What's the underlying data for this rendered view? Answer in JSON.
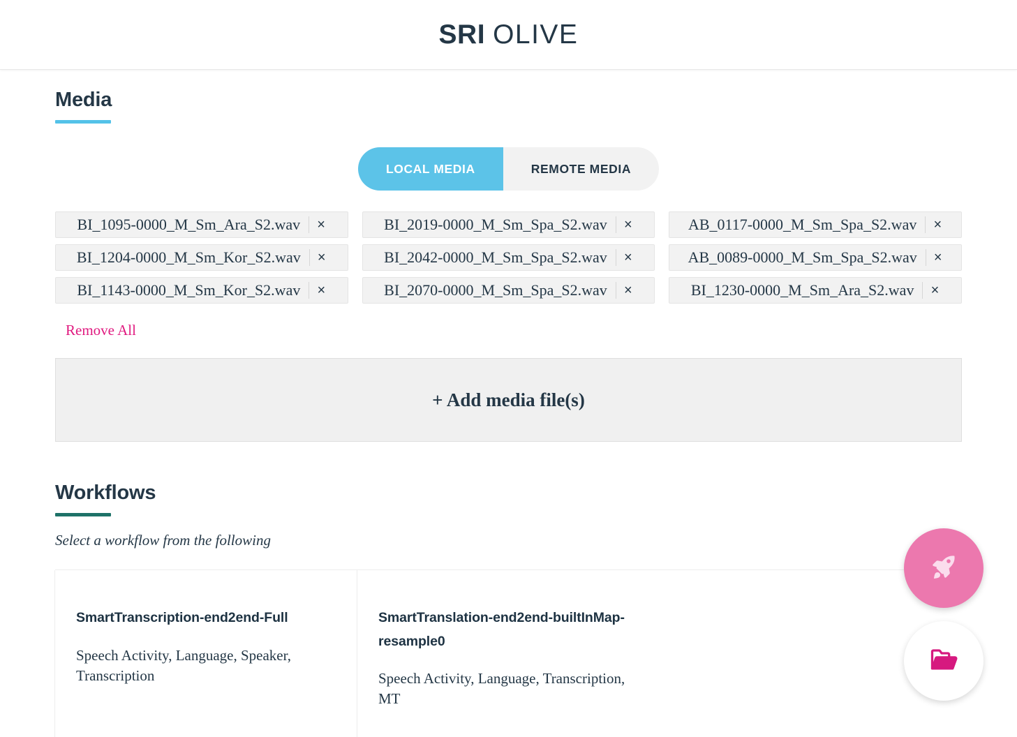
{
  "header": {
    "logo_primary": "SRI",
    "logo_secondary": "OLIVE"
  },
  "media": {
    "section_title": "Media",
    "toggle": {
      "local_label": "LOCAL MEDIA",
      "remote_label": "REMOTE MEDIA",
      "active": "LOCAL MEDIA"
    },
    "files": [
      {
        "name": "BI_1095-0000_M_Sm_Ara_S2.wav",
        "close": "×"
      },
      {
        "name": "BI_2019-0000_M_Sm_Spa_S2.wav",
        "close": "×"
      },
      {
        "name": "AB_0117-0000_M_Sm_Spa_S2.wav",
        "close": "×"
      },
      {
        "name": "BI_1204-0000_M_Sm_Kor_S2.wav",
        "close": "×"
      },
      {
        "name": "BI_2042-0000_M_Sm_Spa_S2.wav",
        "close": "×"
      },
      {
        "name": "AB_0089-0000_M_Sm_Spa_S2.wav",
        "close": "×"
      },
      {
        "name": "BI_1143-0000_M_Sm_Kor_S2.wav",
        "close": "×"
      },
      {
        "name": "BI_2070-0000_M_Sm_Spa_S2.wav",
        "close": "×"
      },
      {
        "name": "BI_1230-0000_M_Sm_Ara_S2.wav",
        "close": "×"
      }
    ],
    "remove_all_label": "Remove All",
    "add_media_label": "+ Add media file(s)"
  },
  "workflows": {
    "section_title": "Workflows",
    "subtitle": "Select a workflow from the following",
    "cards": [
      {
        "title": "SmartTranscription-end2end-Full",
        "description": "Speech Activity, Language, Speaker, Transcription"
      },
      {
        "title": "SmartTranslation-end2end-builtInMap-resample0",
        "description": "Speech Activity, Language, Transcription, MT"
      }
    ]
  },
  "fabs": [
    {
      "icon": "rocket-icon",
      "color": "#ec78ae"
    },
    {
      "icon": "folder-open-icon",
      "color": "#d6197f"
    }
  ],
  "colors": {
    "brand_navy": "#243746",
    "accent_blue": "#54c2e8",
    "accent_teal": "#1e7268",
    "accent_pink": "#e0197f",
    "fab_pink": "#ec78ae"
  }
}
